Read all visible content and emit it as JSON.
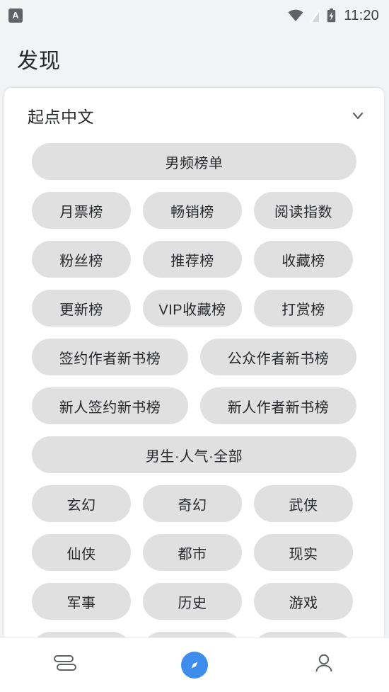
{
  "status_bar": {
    "notification_icon_letter": "A",
    "icons": [
      "wifi-icon",
      "signal-off-icon",
      "battery-charging-icon"
    ],
    "time": "11:20"
  },
  "header": {
    "title": "发现"
  },
  "card": {
    "source_name": "起点中文",
    "expand_icon": "chevron-down-icon",
    "sections": [
      {
        "heading": "男频榜单",
        "rows": [
          [
            "月票榜",
            "畅销榜",
            "阅读指数"
          ],
          [
            "粉丝榜",
            "推荐榜",
            "收藏榜"
          ],
          [
            "更新榜",
            "VIP收藏榜",
            "打赏榜"
          ],
          [
            "签约作者新书榜",
            "公众作者新书榜"
          ],
          [
            "新人签约新书榜",
            "新人作者新书榜"
          ]
        ]
      },
      {
        "heading": "男生·人气·全部",
        "rows": [
          [
            "玄幻",
            "奇幻",
            "武侠"
          ],
          [
            "仙侠",
            "都市",
            "现实"
          ],
          [
            "军事",
            "历史",
            "游戏"
          ]
        ]
      }
    ]
  },
  "bottom_nav": {
    "items": [
      {
        "name": "bookshelf",
        "icon": "books-icon",
        "active": false
      },
      {
        "name": "discover",
        "icon": "compass-icon",
        "active": true
      },
      {
        "name": "profile",
        "icon": "person-icon",
        "active": false
      }
    ],
    "active_color": "#3e8ded"
  }
}
